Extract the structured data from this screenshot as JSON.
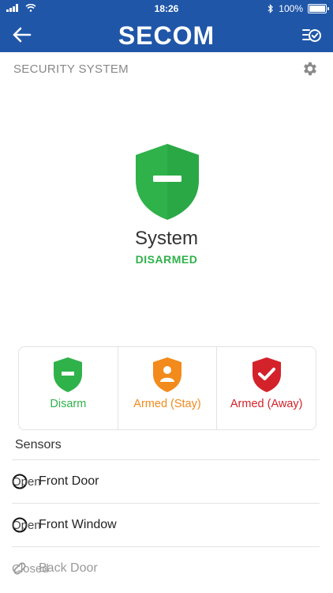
{
  "status_bar": {
    "time": "18:26",
    "battery": "100%"
  },
  "header": {
    "logo": "SECOM",
    "back_icon": "back-arrow-icon",
    "right_icon": "checklist-icon"
  },
  "section": {
    "title": "SECURITY SYSTEM",
    "icon": "gear-icon"
  },
  "system": {
    "title": "System",
    "state": "DISARMED"
  },
  "modes": [
    {
      "label": "Disarm",
      "color": "#2fb24a",
      "icon": "shield-minus-icon"
    },
    {
      "label": "Armed (Stay)",
      "color": "#f28a1c",
      "icon": "shield-person-icon"
    },
    {
      "label": "Armed (Away)",
      "color": "#d3222a",
      "icon": "shield-check-icon"
    }
  ],
  "sensors": {
    "title": "Sensors",
    "items": [
      {
        "name": "Front Door",
        "status": "Open",
        "icon": "circle-icon"
      },
      {
        "name": "Front Window",
        "status": "Open",
        "icon": "circle-icon"
      },
      {
        "name": "Back Door",
        "status": "Closed",
        "icon": "pill-icon"
      }
    ]
  },
  "colors": {
    "brand": "#1f56a8",
    "disarmed": "#2fb24a",
    "stay": "#f28a1c",
    "away": "#d3222a"
  }
}
